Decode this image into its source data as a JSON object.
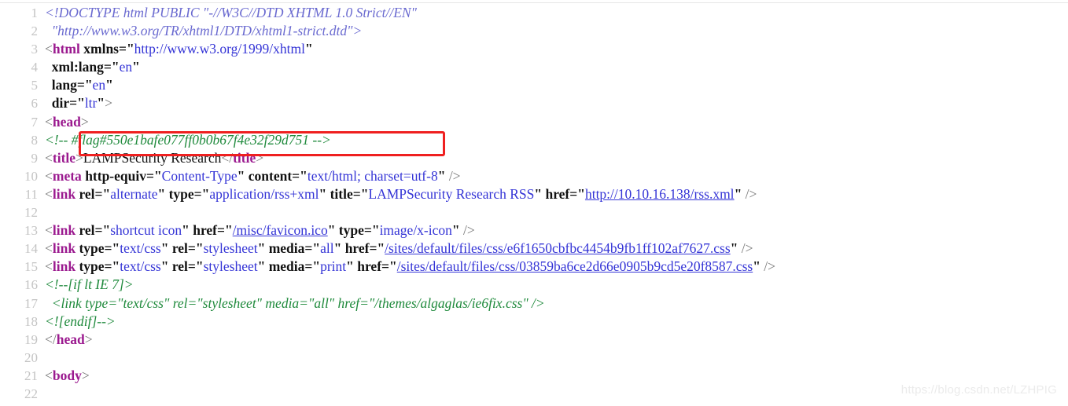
{
  "viewer": {
    "title": "source-code-viewer",
    "background_color": "#ffffff",
    "line_number_color": "#c4c4c4",
    "font_size_px": 17.5
  },
  "highlight": {
    "name": "flag-highlight-box",
    "color": "#ef2020",
    "content": "#flag#550e1bafe077ff0b0b67f4e32f29d751"
  },
  "watermark": {
    "text": "https://blog.csdn.net/LZHPIG",
    "color": "#ebebeb"
  },
  "colors": {
    "doctype": "#6a6ad0",
    "comment": "#1f8a3c",
    "tag": "#9b1a8f",
    "attribute": "#111111",
    "value": "#3434d6",
    "link": "#3434d6",
    "text": "#111111",
    "punctuation": "#7a7a7a",
    "highlight_box": "#ef2020"
  },
  "code": {
    "first_line": 1,
    "last_line": 22,
    "lines": [
      {
        "n": "1",
        "text": "<!DOCTYPE html PUBLIC \"-//W3C//DTD XHTML 1.0 Strict//EN\""
      },
      {
        "n": "2",
        "text": "  \"http://www.w3.org/TR/xhtml1/DTD/xhtml1-strict.dtd\">"
      },
      {
        "n": "3",
        "text": "<html xmlns=\"http://www.w3.org/1999/xhtml\""
      },
      {
        "n": "4",
        "text": "  xml:lang=\"en\""
      },
      {
        "n": "5",
        "text": "  lang=\"en\""
      },
      {
        "n": "6",
        "text": "  dir=\"ltr\">"
      },
      {
        "n": "7",
        "text": "<head>"
      },
      {
        "n": "8",
        "text": "<!-- #flag#550e1bafe077ff0b0b67f4e32f29d751 -->"
      },
      {
        "n": "9",
        "text": "<title>LAMPSecurity Research</title>"
      },
      {
        "n": "10",
        "text": "<meta http-equiv=\"Content-Type\" content=\"text/html; charset=utf-8\" />"
      },
      {
        "n": "11",
        "text": "<link rel=\"alternate\" type=\"application/rss+xml\" title=\"LAMPSecurity Research RSS\" href=\"http://10.10.16.138/rss.xml\" />"
      },
      {
        "n": "12",
        "text": ""
      },
      {
        "n": "13",
        "text": "<link rel=\"shortcut icon\" href=\"/misc/favicon.ico\" type=\"image/x-icon\" />"
      },
      {
        "n": "14",
        "text": "<link type=\"text/css\" rel=\"stylesheet\" media=\"all\" href=\"/sites/default/files/css/e6f1650cbfbc4454b9fb1ff102af7627.css\" />"
      },
      {
        "n": "15",
        "text": "<link type=\"text/css\" rel=\"stylesheet\" media=\"print\" href=\"/sites/default/files/css/03859ba6ce2d66e0905b9cd5e20f8587.css\" />"
      },
      {
        "n": "16",
        "text": "<!--[if lt IE 7]>"
      },
      {
        "n": "17",
        "text": "  <link type=\"text/css\" rel=\"stylesheet\" media=\"all\" href=\"/themes/algaglas/ie6fix.css\" />"
      },
      {
        "n": "18",
        "text": "<![endif]-->"
      },
      {
        "n": "19",
        "text": "</head>"
      },
      {
        "n": "20",
        "text": ""
      },
      {
        "n": "21",
        "text": "<body>"
      },
      {
        "n": "22",
        "text": ""
      }
    ],
    "tokens": [
      [
        {
          "c": "doctype",
          "s": "<!DOCTYPE html PUBLIC \"-//W3C//DTD XHTML 1.0 Strict//EN\""
        }
      ],
      [
        {
          "c": "doctype",
          "s": "  \"http://www.w3.org/TR/xhtml1/DTD/xhtml1-strict.dtd\">"
        }
      ],
      [
        {
          "c": "punct",
          "s": "<"
        },
        {
          "c": "tag",
          "s": "html"
        },
        {
          "c": "text",
          "s": " "
        },
        {
          "c": "attr",
          "s": "xmlns"
        },
        {
          "c": "eq",
          "s": "=\""
        },
        {
          "c": "value",
          "s": "http://www.w3.org/1999/xhtml"
        },
        {
          "c": "quote",
          "s": "\""
        }
      ],
      [
        {
          "c": "text",
          "s": "  "
        },
        {
          "c": "attr",
          "s": "xml:lang"
        },
        {
          "c": "eq",
          "s": "=\""
        },
        {
          "c": "value",
          "s": "en"
        },
        {
          "c": "quote",
          "s": "\""
        }
      ],
      [
        {
          "c": "text",
          "s": "  "
        },
        {
          "c": "attr",
          "s": "lang"
        },
        {
          "c": "eq",
          "s": "=\""
        },
        {
          "c": "value",
          "s": "en"
        },
        {
          "c": "quote",
          "s": "\""
        }
      ],
      [
        {
          "c": "text",
          "s": "  "
        },
        {
          "c": "attr",
          "s": "dir"
        },
        {
          "c": "eq",
          "s": "=\""
        },
        {
          "c": "value",
          "s": "ltr"
        },
        {
          "c": "quote",
          "s": "\""
        },
        {
          "c": "punct",
          "s": ">"
        }
      ],
      [
        {
          "c": "punct",
          "s": "<"
        },
        {
          "c": "tag",
          "s": "head"
        },
        {
          "c": "punct",
          "s": ">"
        }
      ],
      [
        {
          "c": "comment",
          "s": "<!-- "
        },
        {
          "c": "comment",
          "s": "#flag#550e1bafe077ff0b0b67f4e32f29d751"
        },
        {
          "c": "comment",
          "s": " -->"
        }
      ],
      [
        {
          "c": "punct",
          "s": "<"
        },
        {
          "c": "tag",
          "s": "title"
        },
        {
          "c": "punct",
          "s": ">"
        },
        {
          "c": "text",
          "s": "LAMPSecurity Research"
        },
        {
          "c": "punct",
          "s": "</"
        },
        {
          "c": "tag",
          "s": "title"
        },
        {
          "c": "punct",
          "s": ">"
        }
      ],
      [
        {
          "c": "punct",
          "s": "<"
        },
        {
          "c": "tag",
          "s": "meta"
        },
        {
          "c": "text",
          "s": " "
        },
        {
          "c": "attr",
          "s": "http-equiv"
        },
        {
          "c": "eq",
          "s": "=\""
        },
        {
          "c": "value",
          "s": "Content-Type"
        },
        {
          "c": "quote",
          "s": "\""
        },
        {
          "c": "text",
          "s": " "
        },
        {
          "c": "attr",
          "s": "content"
        },
        {
          "c": "eq",
          "s": "=\""
        },
        {
          "c": "value",
          "s": "text/html; charset=utf-8"
        },
        {
          "c": "quote",
          "s": "\""
        },
        {
          "c": "punct",
          "s": " />"
        }
      ],
      [
        {
          "c": "punct",
          "s": "<"
        },
        {
          "c": "tag",
          "s": "link"
        },
        {
          "c": "text",
          "s": " "
        },
        {
          "c": "attr",
          "s": "rel"
        },
        {
          "c": "eq",
          "s": "=\""
        },
        {
          "c": "value",
          "s": "alternate"
        },
        {
          "c": "quote",
          "s": "\""
        },
        {
          "c": "text",
          "s": " "
        },
        {
          "c": "attr",
          "s": "type"
        },
        {
          "c": "eq",
          "s": "=\""
        },
        {
          "c": "value",
          "s": "application/rss+xml"
        },
        {
          "c": "quote",
          "s": "\""
        },
        {
          "c": "text",
          "s": " "
        },
        {
          "c": "attr",
          "s": "title"
        },
        {
          "c": "eq",
          "s": "=\""
        },
        {
          "c": "value",
          "s": "LAMPSecurity Research RSS"
        },
        {
          "c": "quote",
          "s": "\""
        },
        {
          "c": "text",
          "s": " "
        },
        {
          "c": "attr",
          "s": "href"
        },
        {
          "c": "eq",
          "s": "=\""
        },
        {
          "c": "link",
          "s": "http://10.10.16.138/rss.xml"
        },
        {
          "c": "quote",
          "s": "\""
        },
        {
          "c": "punct",
          "s": " />"
        }
      ],
      [],
      [
        {
          "c": "punct",
          "s": "<"
        },
        {
          "c": "tag",
          "s": "link"
        },
        {
          "c": "text",
          "s": " "
        },
        {
          "c": "attr",
          "s": "rel"
        },
        {
          "c": "eq",
          "s": "=\""
        },
        {
          "c": "value",
          "s": "shortcut icon"
        },
        {
          "c": "quote",
          "s": "\""
        },
        {
          "c": "text",
          "s": " "
        },
        {
          "c": "attr",
          "s": "href"
        },
        {
          "c": "eq",
          "s": "=\""
        },
        {
          "c": "link",
          "s": "/misc/favicon.ico"
        },
        {
          "c": "quote",
          "s": "\""
        },
        {
          "c": "text",
          "s": " "
        },
        {
          "c": "attr",
          "s": "type"
        },
        {
          "c": "eq",
          "s": "=\""
        },
        {
          "c": "value",
          "s": "image/x-icon"
        },
        {
          "c": "quote",
          "s": "\""
        },
        {
          "c": "punct",
          "s": " />"
        }
      ],
      [
        {
          "c": "punct",
          "s": "<"
        },
        {
          "c": "tag",
          "s": "link"
        },
        {
          "c": "text",
          "s": " "
        },
        {
          "c": "attr",
          "s": "type"
        },
        {
          "c": "eq",
          "s": "=\""
        },
        {
          "c": "value",
          "s": "text/css"
        },
        {
          "c": "quote",
          "s": "\""
        },
        {
          "c": "text",
          "s": " "
        },
        {
          "c": "attr",
          "s": "rel"
        },
        {
          "c": "eq",
          "s": "=\""
        },
        {
          "c": "value",
          "s": "stylesheet"
        },
        {
          "c": "quote",
          "s": "\""
        },
        {
          "c": "text",
          "s": " "
        },
        {
          "c": "attr",
          "s": "media"
        },
        {
          "c": "eq",
          "s": "=\""
        },
        {
          "c": "value",
          "s": "all"
        },
        {
          "c": "quote",
          "s": "\""
        },
        {
          "c": "text",
          "s": " "
        },
        {
          "c": "attr",
          "s": "href"
        },
        {
          "c": "eq",
          "s": "=\""
        },
        {
          "c": "link",
          "s": "/sites/default/files/css/e6f1650cbfbc4454b9fb1ff102af7627.css"
        },
        {
          "c": "quote",
          "s": "\""
        },
        {
          "c": "punct",
          "s": " />"
        }
      ],
      [
        {
          "c": "punct",
          "s": "<"
        },
        {
          "c": "tag",
          "s": "link"
        },
        {
          "c": "text",
          "s": " "
        },
        {
          "c": "attr",
          "s": "type"
        },
        {
          "c": "eq",
          "s": "=\""
        },
        {
          "c": "value",
          "s": "text/css"
        },
        {
          "c": "quote",
          "s": "\""
        },
        {
          "c": "text",
          "s": " "
        },
        {
          "c": "attr",
          "s": "rel"
        },
        {
          "c": "eq",
          "s": "=\""
        },
        {
          "c": "value",
          "s": "stylesheet"
        },
        {
          "c": "quote",
          "s": "\""
        },
        {
          "c": "text",
          "s": " "
        },
        {
          "c": "attr",
          "s": "media"
        },
        {
          "c": "eq",
          "s": "=\""
        },
        {
          "c": "value",
          "s": "print"
        },
        {
          "c": "quote",
          "s": "\""
        },
        {
          "c": "text",
          "s": " "
        },
        {
          "c": "attr",
          "s": "href"
        },
        {
          "c": "eq",
          "s": "=\""
        },
        {
          "c": "link",
          "s": "/sites/default/files/css/03859ba6ce2d66e0905b9cd5e20f8587.css"
        },
        {
          "c": "quote",
          "s": "\""
        },
        {
          "c": "punct",
          "s": " />"
        }
      ],
      [
        {
          "c": "comment",
          "s": "<!--[if lt IE 7]>"
        }
      ],
      [
        {
          "c": "comment",
          "s": "  <link type=\"text/css\" rel=\"stylesheet\" media=\"all\" href=\"/themes/algaglas/ie6fix.css\" />"
        }
      ],
      [
        {
          "c": "comment",
          "s": "<![endif]-->"
        }
      ],
      [
        {
          "c": "punct",
          "s": "</"
        },
        {
          "c": "tag",
          "s": "head"
        },
        {
          "c": "punct",
          "s": ">"
        }
      ],
      [],
      [
        {
          "c": "punct",
          "s": "<"
        },
        {
          "c": "tag",
          "s": "body"
        },
        {
          "c": "punct",
          "s": ">"
        }
      ],
      []
    ]
  }
}
